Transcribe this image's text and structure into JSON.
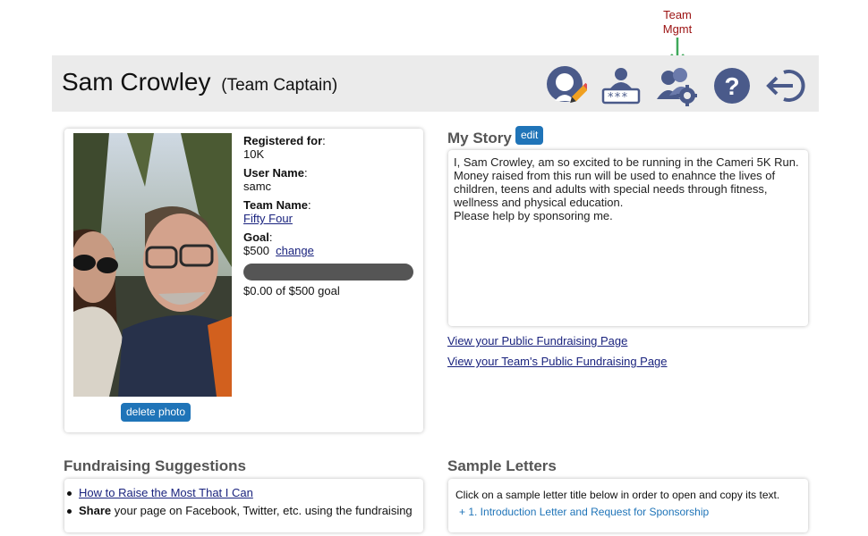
{
  "annotation": {
    "line1": "Team",
    "line2": "Mgmt",
    "color": "#9b1111",
    "arrow_color": "#3fa85a"
  },
  "header": {
    "name": "Sam Crowley",
    "role": "(Team Captain)",
    "icons": [
      "edit-profile-icon",
      "password-icon",
      "team-management-icon",
      "help-icon",
      "logout-icon"
    ],
    "icon_color": "#4a5a8a"
  },
  "profile": {
    "delete_photo": "delete photo",
    "registered_label": "Registered for",
    "registered_value": "10K",
    "username_label": "User Name",
    "username_value": "samc",
    "team_label": "Team Name",
    "team_value": "Fifty Four",
    "goal_label": "Goal",
    "goal_value": "$500",
    "change_link": "change",
    "progress_fraction": 0,
    "progress_text": "$0.00 of $500 goal"
  },
  "story": {
    "title": "My Story",
    "edit": "edit",
    "text": "I, Sam Crowley, am so excited to be running in the Cameri 5K Run. Money raised from this run will be used to enahnce the lives of children, teens and adults with special needs through fitness, wellness and physical education.\nPlease help by sponsoring me.",
    "public_link": "View your Public Fundraising Page",
    "team_link": "View your Team's Public Fundraising Page"
  },
  "fundraising": {
    "title": "Fundraising Suggestions",
    "item1": "How to Raise the Most That I Can",
    "item2_bold": "Share",
    "item2_rest": " your page on Facebook, Twitter, etc. using the fundraising"
  },
  "letters": {
    "title": "Sample Letters",
    "intro": "Click on a sample letter title below in order to open and copy its text.",
    "item1": "+ 1. Introduction Letter and Request for Sponsorship"
  },
  "colors": {
    "accent": "#1f74b8",
    "link": "#1a237e",
    "header_bg": "#ebebeb",
    "progress_bg": "#555555"
  }
}
